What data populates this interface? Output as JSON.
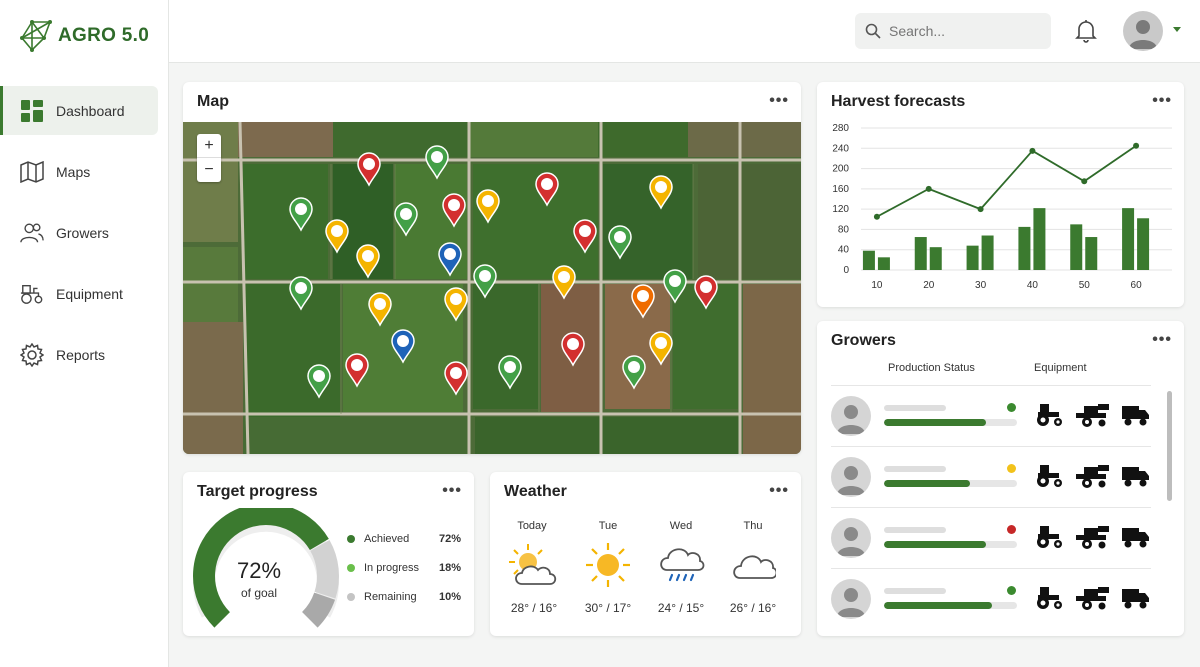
{
  "app": {
    "logo_text": "AGRO 5.0"
  },
  "sidebar": {
    "items": [
      {
        "label": "Dashboard",
        "icon": "dashboard-icon",
        "active": true
      },
      {
        "label": "Maps",
        "icon": "map-icon"
      },
      {
        "label": "Growers",
        "icon": "users-icon"
      },
      {
        "label": "Equipment",
        "icon": "tractor-icon"
      },
      {
        "label": "Reports",
        "icon": "gear-icon"
      }
    ]
  },
  "topbar": {
    "search_placeholder": "Search..."
  },
  "map": {
    "title": "Map",
    "zoom_in": "+",
    "zoom_out": "−"
  },
  "harvest": {
    "title": "Harvest forecasts"
  },
  "growers": {
    "title": "Growers",
    "col_status": "Production Status",
    "col_equipment": "Equipment",
    "rows": [
      {
        "progress": 0.77,
        "status_color": "#3b8a2f"
      },
      {
        "progress": 0.65,
        "status_color": "#f2c21b"
      },
      {
        "progress": 0.77,
        "status_color": "#c62828"
      },
      {
        "progress": 0.81,
        "status_color": "#3b8a2f"
      }
    ]
  },
  "target": {
    "title": "Target progress",
    "center_value": "72%",
    "center_label": "of goal",
    "legend": [
      {
        "label": "Achieved",
        "value": "72%",
        "color": "#3b7a2f"
      },
      {
        "label": "In progress",
        "value": "18%",
        "color": "#6abf4b"
      },
      {
        "label": "Remaining",
        "value": "10%",
        "color": "#c4c4c4"
      }
    ]
  },
  "weather": {
    "title": "Weather",
    "days": [
      {
        "day": "Today",
        "temp": "28° / 16°",
        "icon": "partly-cloudy-icon"
      },
      {
        "day": "Tue",
        "temp": "30° / 17°",
        "icon": "sun-icon"
      },
      {
        "day": "Wed",
        "temp": "24° / 15°",
        "icon": "rain-icon"
      },
      {
        "day": "Thu",
        "temp": "26° / 16°",
        "icon": "cloud-icon"
      }
    ]
  },
  "chart_data": {
    "type": "bar",
    "categories": [
      "10",
      "20",
      "30",
      "40",
      "50",
      "60"
    ],
    "series": [
      {
        "values": [
          38,
          65,
          48,
          85,
          90,
          122
        ],
        "kind": "bar"
      },
      {
        "values": [
          25,
          45,
          68,
          122,
          65,
          102
        ],
        "kind": "bar"
      },
      {
        "values": [
          105,
          160,
          120,
          235,
          175,
          245
        ],
        "kind": "line"
      }
    ],
    "yticks": [
      0,
      40,
      80,
      120,
      160,
      200,
      240,
      280
    ],
    "ylim": [
      0,
      280
    ],
    "colors": {
      "bar": "#3b7a2f",
      "line": "#2f6b2a"
    },
    "grid": true
  }
}
